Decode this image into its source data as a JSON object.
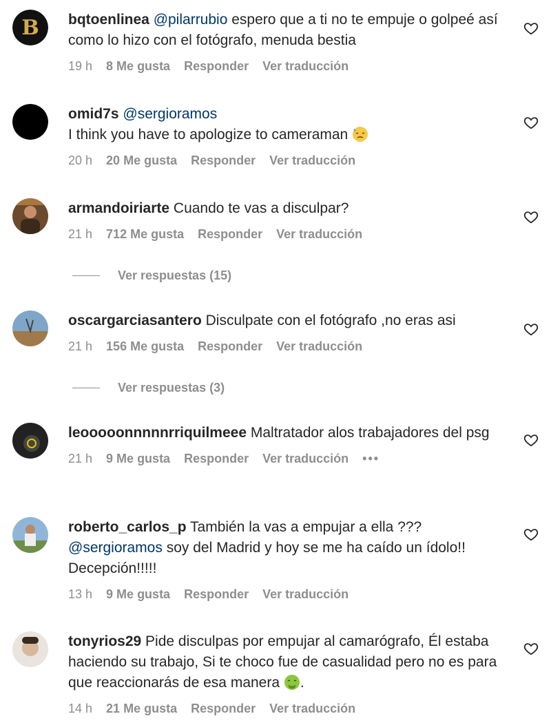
{
  "comments": [
    {
      "username": "bqtoenlinea",
      "mention": "@pilarrubio",
      "text": " espero que a ti no te empuje o golpeé así como lo hizo con el fotógrafo, menuda bestia",
      "time": "19 h",
      "likes": "8 Me gusta",
      "reply": "Responder",
      "translate": "Ver traducción",
      "avatar_icon": "logo-b-avatar"
    },
    {
      "username": "omid7s",
      "mention": "@sergioramos",
      "text": "I think you have to apologize to cameraman",
      "time": "20 h",
      "likes": "20 Me gusta",
      "reply": "Responder",
      "translate": "Ver traducción",
      "emoji": "sad-sweat-emoji"
    },
    {
      "username": "armandoiriarte",
      "text": "Cuando te vas a disculpar?",
      "time": "21 h",
      "likes": "712 Me gusta",
      "reply": "Responder",
      "translate": "Ver traducción",
      "replies": "Ver respuestas (15)"
    },
    {
      "username": "oscargarciasantero",
      "text": "Disculpate con el fotógrafo ,no eras asi",
      "time": "21 h",
      "likes": "156 Me gusta",
      "reply": "Responder",
      "translate": "Ver traducción",
      "replies": "Ver respuestas (3)"
    },
    {
      "username": "leooooonnnnnrriquilmeee",
      "text": "Maltratador alos trabajadores del psg",
      "time": "21 h",
      "likes": "9 Me gusta",
      "reply": "Responder",
      "translate": "Ver traducción",
      "more": "•••"
    },
    {
      "username": "roberto_carlos_p",
      "text": "También la vas a empujar a ella ???",
      "mention": "@sergioramos",
      "text2": " soy del Madrid y hoy se me ha caído un ídolo!! Decepción!!!!!",
      "time": "13 h",
      "likes": "9 Me gusta",
      "reply": "Responder",
      "translate": "Ver traducción"
    },
    {
      "username": "tonyrios29",
      "text": "Pide disculpas por empujar al camarógrafo, Él estaba haciendo su trabajo, Si te choco fue de casualidad pero no es para que reaccionarás de esa manera",
      "text_end": ".",
      "time": "14 h",
      "likes": "21 Me gusta",
      "reply": "Responder",
      "translate": "Ver traducción",
      "emoji": "nauseated-emoji"
    }
  ],
  "colors": {
    "text": "#262626",
    "meta": "#8e8e8e",
    "mention": "#00376b",
    "background": "#ffffff"
  }
}
